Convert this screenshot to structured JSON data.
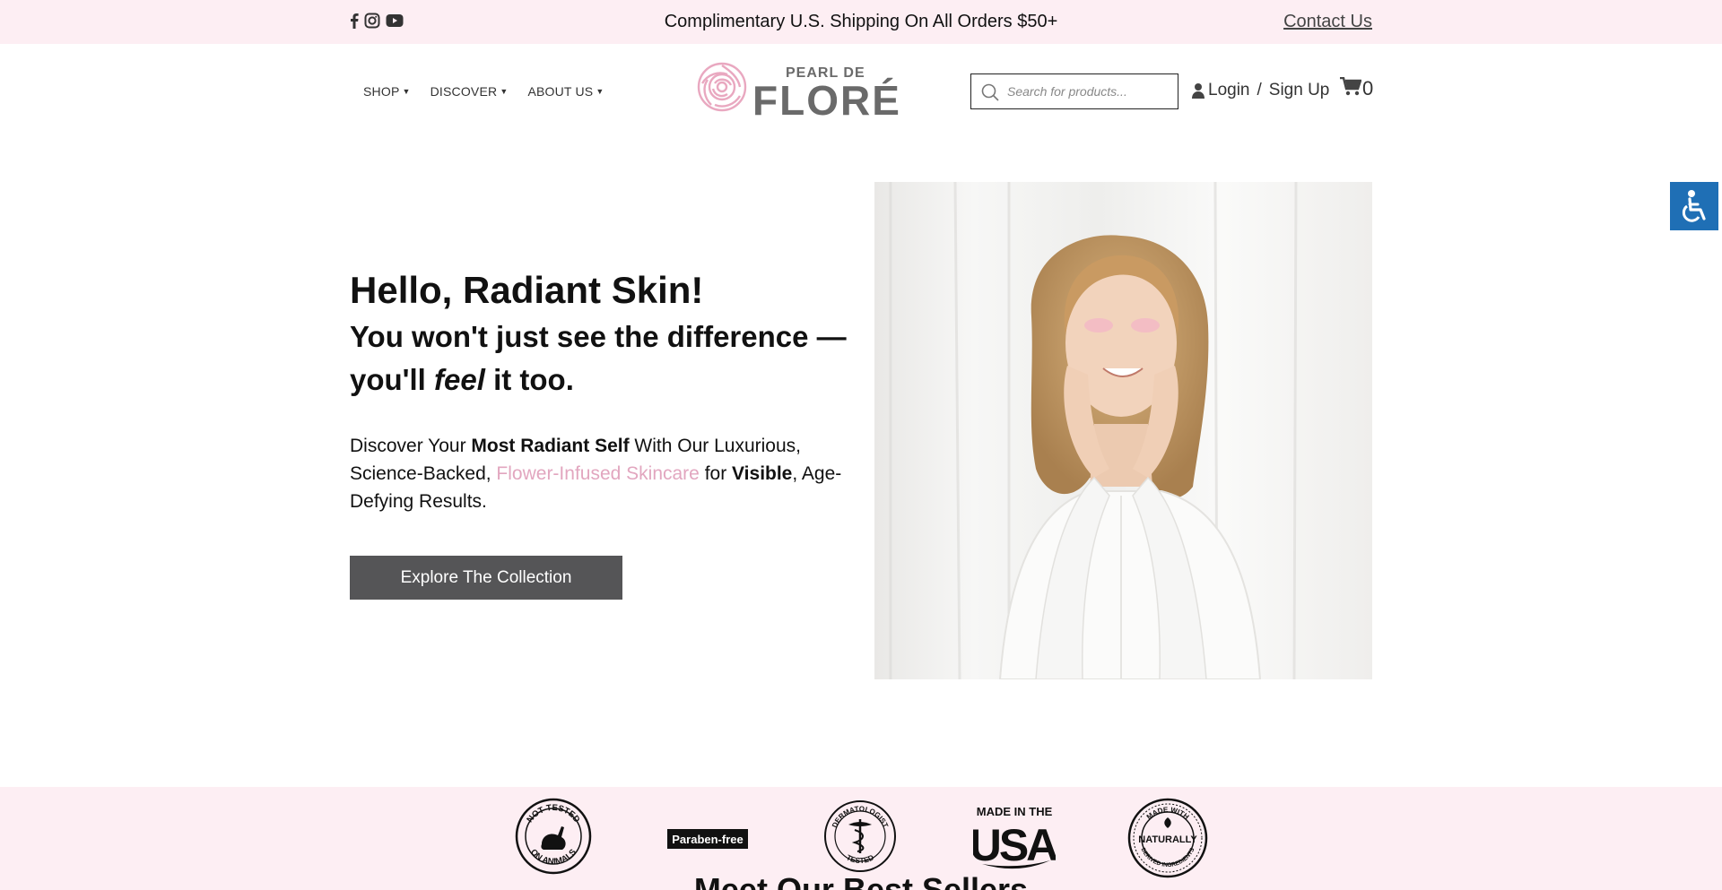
{
  "topbar": {
    "announcement": "Complimentary U.S. Shipping On All Orders $50+",
    "contact_label": "Contact Us",
    "social": [
      "facebook-icon",
      "instagram-icon",
      "youtube-icon"
    ]
  },
  "header": {
    "nav": [
      {
        "label": "SHOP"
      },
      {
        "label": "DISCOVER"
      },
      {
        "label": "ABOUT US"
      }
    ],
    "logo_top": "PEARL DE",
    "logo_main": "FLORÉ",
    "search_placeholder": "Search for products...",
    "login_label": "Login",
    "separator": "/",
    "signup_label": "Sign Up",
    "cart_count": "0"
  },
  "hero": {
    "title": "Hello, Radiant Skin!",
    "subtitle_part1": "You won't just see the difference —you'll ",
    "subtitle_em": "feel",
    "subtitle_part2": " it too.",
    "lead_1": "Discover Your ",
    "lead_bold_1": "Most Radiant Self",
    "lead_2": " With Our Luxurious, Science-Backed, ",
    "lead_pink": "Flower-Infused Skincare",
    "lead_3": " for ",
    "lead_bold_2": "Visible",
    "lead_4": ", Age-Defying Results.",
    "cta_label": "Explore The Collection"
  },
  "badges": {
    "not_tested_top": "NOT TESTED",
    "not_tested_bottom": "ON ANIMALS",
    "paraben": "Paraben-free",
    "derm_top": "DERMATOLOGIST",
    "derm_bottom": "TESTED",
    "made_in": "MADE IN THE",
    "usa": "USA",
    "naturally_top": "MADE WITH",
    "naturally_mid": "NATURALLY",
    "naturally_bottom": "DERIVED INGREDIENTS"
  },
  "section_title": "Meet Our Best Sellers",
  "colors": {
    "topbar_bg": "#fdeef3",
    "accent_pink": "#e2a6bf",
    "button_bg": "#555557",
    "a11y_blue": "#1f6fb5"
  }
}
